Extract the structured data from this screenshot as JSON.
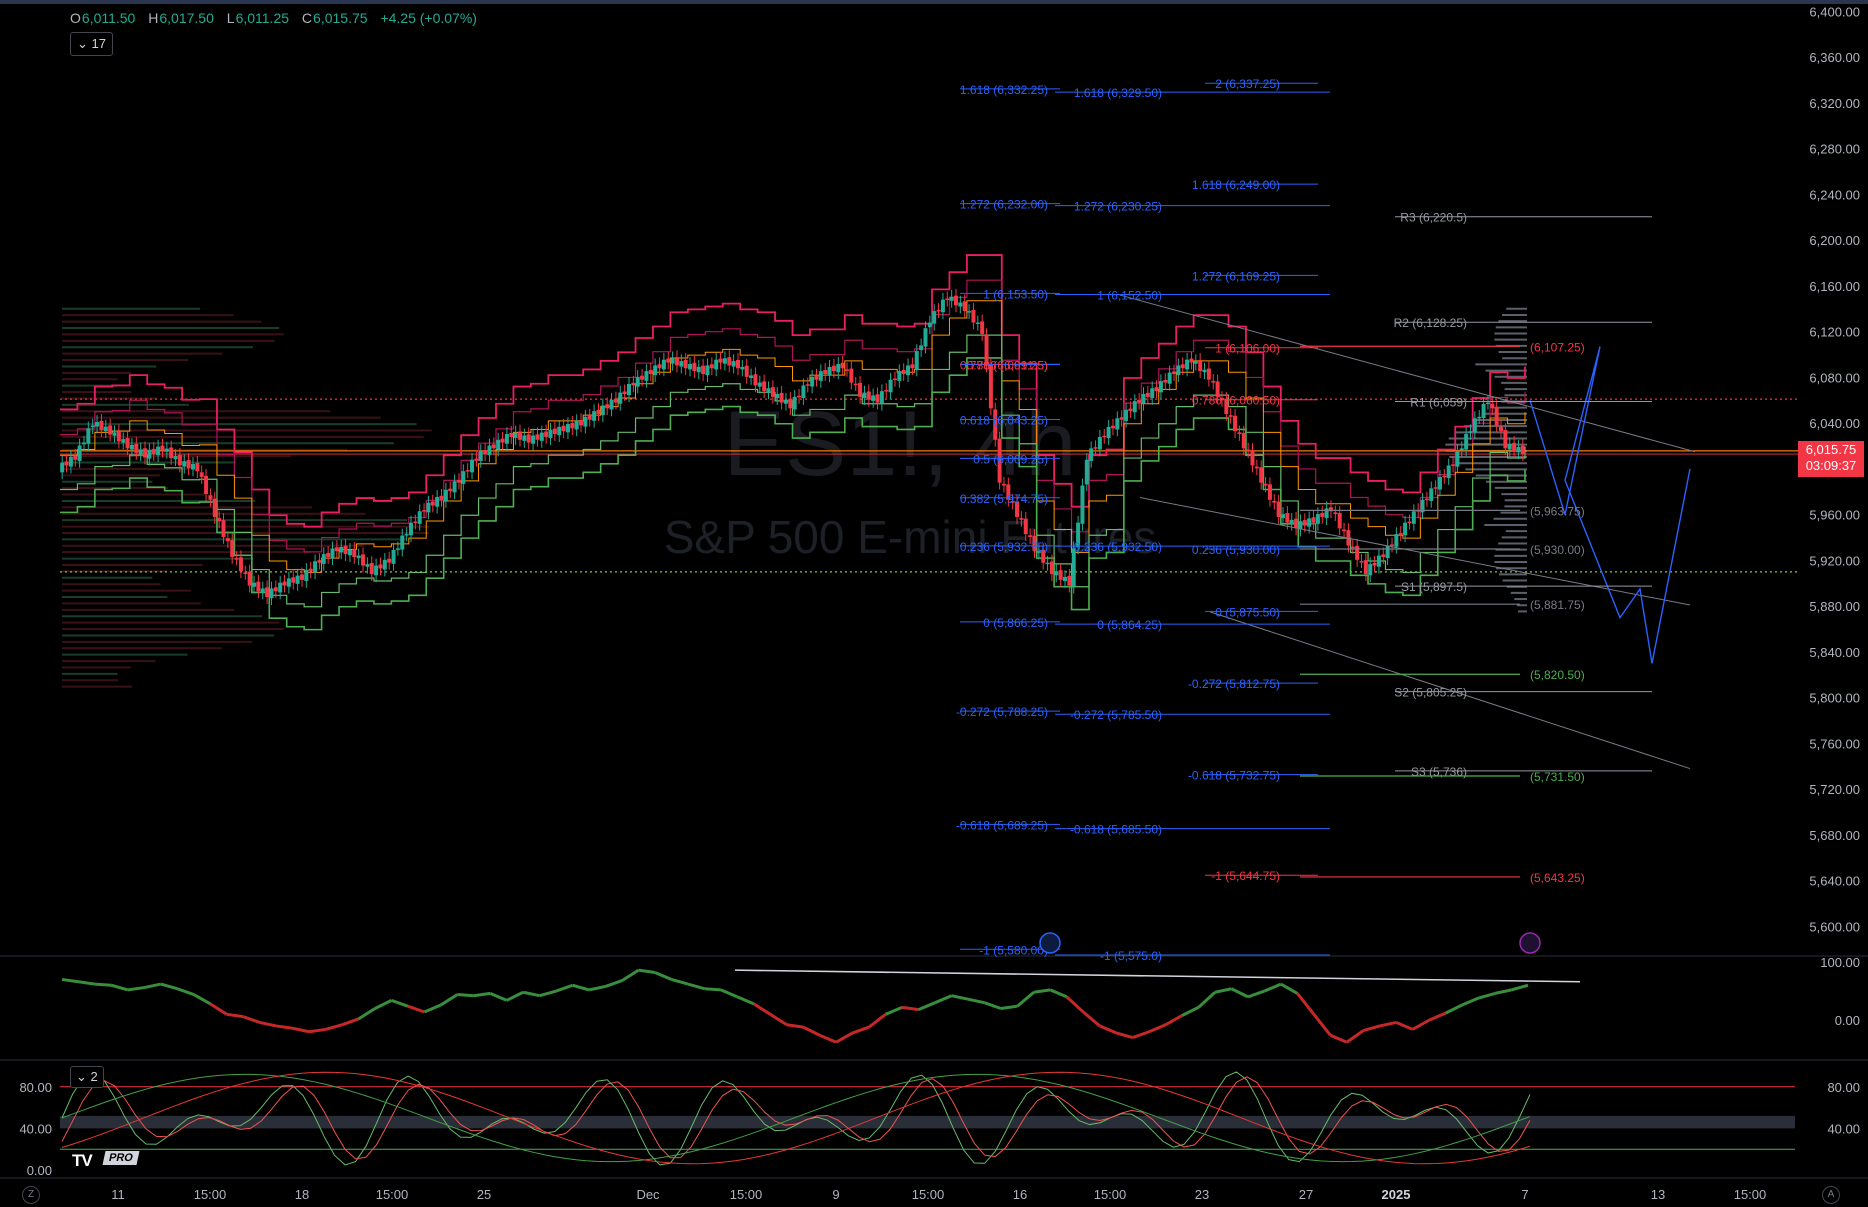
{
  "ohlc": {
    "o_label": "O",
    "o": "6,011.50",
    "h_label": "H",
    "h": "6,017.50",
    "l_label": "L",
    "l": "6,011.25",
    "c_label": "C",
    "c": "6,015.75",
    "change": "+4.25 (+0.07%)"
  },
  "interval_badge": "17",
  "stoch_badge": "2",
  "watermark": {
    "symbol": "ES1!, 4h",
    "name": "S&P 500 E-mini Futures"
  },
  "last_price": {
    "value": "6,015.75",
    "countdown": "03:09:37"
  },
  "logo": {
    "pro": "PRO"
  },
  "colors": {
    "up": "#22ab94",
    "down": "#f23645",
    "upper_band": "#e91e63",
    "lower_band": "#4caf50",
    "fib_blue": "#2962ff",
    "fib_red": "#f23645",
    "fib_green": "#4caf50",
    "axis_text": "#b2b5be"
  },
  "chart_data": [
    {
      "type": "line",
      "subtype": "candlestick",
      "title": "ES1!, 4h",
      "subtitle": "S&P 500 E-mini Futures",
      "ylim": [
        5575,
        6410
      ],
      "y_ticks": [
        {
          "v": 6400,
          "label": "6,400.00"
        },
        {
          "v": 6360,
          "label": "6,360.00"
        },
        {
          "v": 6320,
          "label": "6,320.00"
        },
        {
          "v": 6280,
          "label": "6,280.00"
        },
        {
          "v": 6240,
          "label": "6,240.00"
        },
        {
          "v": 6200,
          "label": "6,200.00"
        },
        {
          "v": 6160,
          "label": "6,160.00"
        },
        {
          "v": 6120,
          "label": "6,120.00"
        },
        {
          "v": 6080,
          "label": "6,080.00"
        },
        {
          "v": 6040,
          "label": "6,040.00"
        },
        {
          "v": 5960,
          "label": "5,960.00"
        },
        {
          "v": 5920,
          "label": "5,920.00"
        },
        {
          "v": 5880,
          "label": "5,880.00"
        },
        {
          "v": 5840,
          "label": "5,840.00"
        },
        {
          "v": 5800,
          "label": "5,800.00"
        },
        {
          "v": 5760,
          "label": "5,760.00"
        },
        {
          "v": 5720,
          "label": "5,720.00"
        },
        {
          "v": 5680,
          "label": "5,680.00"
        },
        {
          "v": 5640,
          "label": "5,640.00"
        },
        {
          "v": 5600,
          "label": "5,600.00"
        }
      ],
      "x_ticks": [
        "11",
        "15:00",
        "18",
        "15:00",
        "25",
        "Dec",
        "15:00",
        "9",
        "15:00",
        "16",
        "15:00",
        "23",
        "27",
        "2025",
        "7",
        "13",
        "15:00"
      ],
      "price_path": [
        6000,
        6010,
        6040,
        6032,
        6020,
        6012,
        6018,
        6005,
        6000,
        5960,
        5925,
        5900,
        5890,
        5900,
        5905,
        5920,
        5930,
        5925,
        5910,
        5920,
        5945,
        5965,
        5975,
        5990,
        6010,
        6020,
        6030,
        6025,
        6030,
        6035,
        6040,
        6050,
        6060,
        6075,
        6085,
        6095,
        6090,
        6085,
        6095,
        6090,
        6075,
        6065,
        6055,
        6075,
        6085,
        6090,
        6065,
        6060,
        6080,
        6090,
        6130,
        6150,
        6140,
        6120,
        5990,
        5960,
        5930,
        5910,
        5900,
        6010,
        6030,
        6045,
        6060,
        6070,
        6085,
        6095,
        6080,
        6050,
        6020,
        5990,
        5960,
        5950,
        5955,
        5965,
        5935,
        5910,
        5925,
        5945,
        5965,
        5985,
        6005,
        6035,
        6060,
        6020,
        6015
      ],
      "levels": {
        "fib_left": [
          {
            "label": "1.618 (6,332.25)",
            "v": 6332.25
          },
          {
            "label": "1.618 (6,329.50)",
            "v": 6329.5
          },
          {
            "label": "1.272 (6,232.00)",
            "v": 6232
          },
          {
            "label": "1.272 (6,230.25)",
            "v": 6230.25
          },
          {
            "label": "1 (6,153.50)",
            "v": 6153.5
          },
          {
            "label": "1 (6,152.50)",
            "v": 6152.5
          },
          {
            "label": "0.786 (6,091.5)",
            "v": 6091.5
          },
          {
            "label": "0.786 (6,091.25)",
            "v": 6091.25
          },
          {
            "label": "0.618 (6,043.25)",
            "v": 6043.25
          },
          {
            "label": "0.5 (6,009.25)",
            "v": 6009.25
          },
          {
            "label": "0.382 (5,974.75)",
            "v": 5974.75
          },
          {
            "label": "0.236 (5,932.50)",
            "v": 5932.5
          },
          {
            "label": "0.236 (5,932.75)",
            "v": 5932.75
          },
          {
            "label": "0 (5,864.25)",
            "v": 5864.25
          },
          {
            "label": "0 (5,866.25)",
            "v": 5866.25
          },
          {
            "label": "-0.272 (5,785.50)",
            "v": 5785.5
          },
          {
            "label": "-0.272 (5,788.25)",
            "v": 5788.25
          },
          {
            "label": "-0.618 (5,685.50)",
            "v": 5685.5
          },
          {
            "label": "-0.618 (5,689.25)",
            "v": 5689.25
          },
          {
            "label": "-1 (5,575.0)",
            "v": 5575
          },
          {
            "label": "-1 (5,580.00)",
            "v": 5580
          }
        ],
        "fib_right": [
          {
            "label": "2 (6,337.25)",
            "v": 6337.25
          },
          {
            "label": "1.618 (6,249.00)",
            "v": 6249
          },
          {
            "label": "1.272 (6,169.25)",
            "v": 6169.25
          },
          {
            "label": "1 (6,106.00)",
            "v": 6106
          },
          {
            "label": "0.786 (6,060.50)",
            "v": 6060.5
          },
          {
            "label": "0.236 (5,930.00)",
            "v": 5930
          },
          {
            "label": "0 (5,875.50)",
            "v": 5875.5
          },
          {
            "label": "-0.272 (5,812.75)",
            "v": 5812.75
          },
          {
            "label": "-0.618 (5,732.75)",
            "v": 5732.75
          },
          {
            "label": "-1 (5,644.75)",
            "v": 5644.75
          }
        ],
        "pivots": [
          {
            "label": "R3 (6,220.5)",
            "v": 6220.5
          },
          {
            "label": "R2 (6,128.25)",
            "v": 6128.25
          },
          {
            "label": "R1 (6,059)",
            "v": 6059
          },
          {
            "label": "S1 (5,897.5)",
            "v": 5897.5
          },
          {
            "label": "S2 (5,805.25)",
            "v": 5805.25
          },
          {
            "label": "S3 (5,736)",
            "v": 5736
          }
        ],
        "side": [
          {
            "label": "(6,107.25)",
            "v": 6107.25,
            "color": "#f23645"
          },
          {
            "label": "(5,963.75)",
            "v": 5963.75,
            "color": "#787b86"
          },
          {
            "label": "(5,930.00)",
            "v": 5930,
            "color": "#787b86"
          },
          {
            "label": "(5,881.75)",
            "v": 5881.75,
            "color": "#787b86"
          },
          {
            "label": "(5,820.50)",
            "v": 5820.5,
            "color": "#4caf50"
          },
          {
            "label": "(5,731.50)",
            "v": 5731.5,
            "color": "#4caf50"
          },
          {
            "label": "(5,643.25)",
            "v": 5643.25,
            "color": "#f23645"
          }
        ]
      }
    },
    {
      "type": "line",
      "name": "oscillator",
      "ylim": [
        -60,
        100
      ],
      "y_ticks": [
        {
          "v": 100,
          "label": "100.00"
        },
        {
          "v": 0,
          "label": "0.00"
        }
      ],
      "values": [
        70,
        66,
        62,
        60,
        52,
        56,
        62,
        54,
        44,
        28,
        10,
        6,
        -4,
        -10,
        -14,
        -20,
        -16,
        -8,
        2,
        20,
        34,
        24,
        14,
        26,
        44,
        42,
        46,
        34,
        48,
        42,
        50,
        60,
        52,
        58,
        68,
        86,
        82,
        70,
        62,
        54,
        52,
        40,
        28,
        10,
        -8,
        -12,
        -26,
        -38,
        -22,
        -12,
        10,
        22,
        18,
        30,
        42,
        36,
        30,
        20,
        24,
        48,
        52,
        40,
        14,
        -10,
        -22,
        -30,
        -20,
        -8,
        8,
        22,
        48,
        54,
        40,
        50,
        62,
        46,
        10,
        -26,
        -38,
        -18,
        -10,
        -4,
        -16,
        0,
        12,
        26,
        38,
        46,
        52,
        60
      ]
    },
    {
      "type": "line",
      "name": "stochastic",
      "ylim": [
        0,
        100
      ],
      "y_ticks": [
        {
          "v": 80,
          "label": "80.00"
        },
        {
          "v": 40,
          "label": "40.00"
        },
        {
          "v": 0,
          "label": "0.00"
        }
      ],
      "right_ticks": [
        {
          "v": 80,
          "label": "80.00"
        },
        {
          "v": 40,
          "label": "40.00"
        }
      ]
    }
  ]
}
